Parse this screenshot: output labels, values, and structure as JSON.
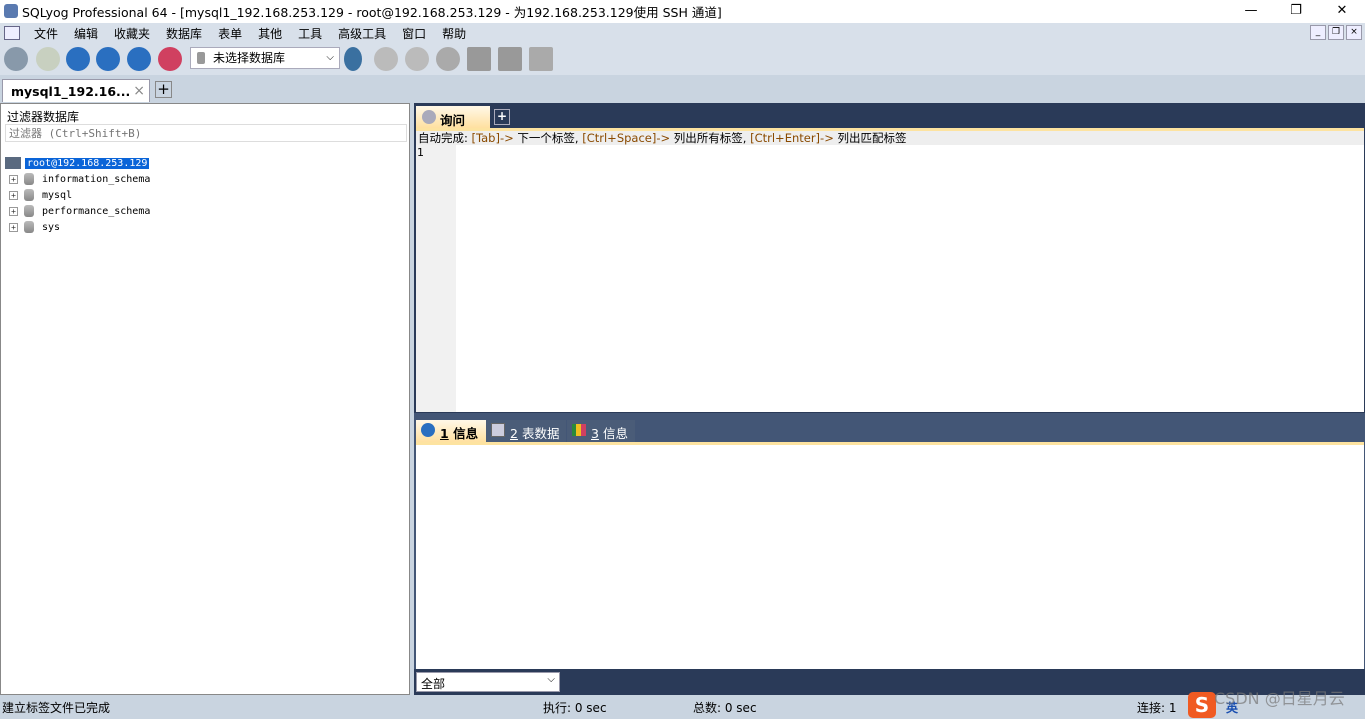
{
  "window": {
    "title": "SQLyog Professional 64 - [mysql1_192.168.253.129 - root@192.168.253.129 - 为192.168.253.129使用 SSH 通道]",
    "minimize": "—",
    "restore": "❐",
    "close": "✕"
  },
  "menu": [
    "文件",
    "编辑",
    "收藏夹",
    "数据库",
    "表单",
    "其他",
    "工具",
    "高级工具",
    "窗口",
    "帮助"
  ],
  "toolbar": {
    "database_select": "未选择数据库"
  },
  "connection_tab": {
    "label": "mysql1_192.16...",
    "close": "×",
    "add": "+"
  },
  "object_browser": {
    "header": "过滤器数据库",
    "filter_placeholder": "过滤器 (Ctrl+Shift+B)",
    "root": "root@192.168.253.129",
    "databases": [
      "information_schema",
      "mysql",
      "performance_schema",
      "sys"
    ]
  },
  "query": {
    "tab": "询问",
    "add": "+",
    "hint": {
      "prefix": "自动完成: ",
      "k1": "[Tab]-> ",
      "t1": "下一个标签, ",
      "k2": "[Ctrl+Space]-> ",
      "t2": "列出所有标签, ",
      "k3": "[Ctrl+Enter]-> ",
      "t3": "列出匹配标签"
    },
    "line_number": "1"
  },
  "result_tabs": [
    {
      "num": "1",
      "label": "信息"
    },
    {
      "num": "2",
      "label": "表数据"
    },
    {
      "num": "3",
      "label": "信息"
    }
  ],
  "result_filter": "全部",
  "status": {
    "message": "建立标签文件已完成",
    "exec": "执行: 0 sec",
    "total": "总数: 0 sec",
    "connections": "连接: 1"
  },
  "overlay": {
    "ime": "英",
    "watermark": "CSDN @日星月云"
  }
}
